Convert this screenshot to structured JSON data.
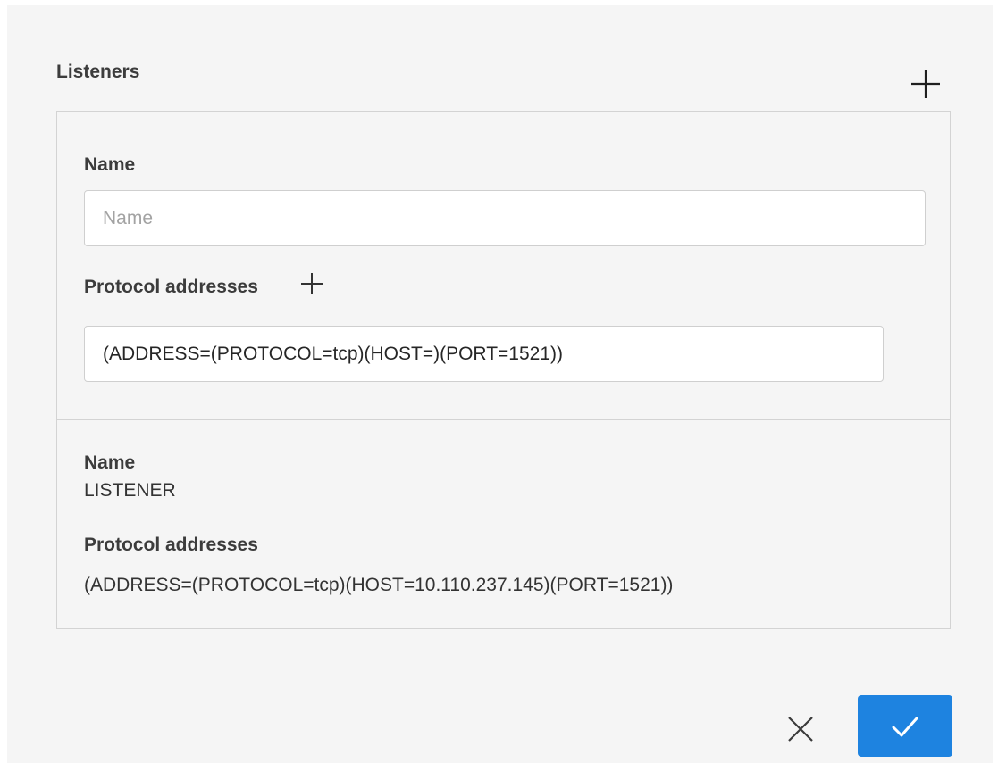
{
  "listeners": {
    "title": "Listeners",
    "add_icon": "plus-icon",
    "editor": {
      "name_label": "Name",
      "name_value": "",
      "name_placeholder": "Name",
      "protocol_label": "Protocol addresses",
      "protocol_add_icon": "plus-icon",
      "protocol_value": "(ADDRESS=(PROTOCOL=tcp)(HOST=)(PORT=1521))"
    },
    "items": [
      {
        "name_label": "Name",
        "name": "LISTENER",
        "protocol_label": "Protocol addresses",
        "protocol": "(ADDRESS=(PROTOCOL=tcp)(HOST=10.110.237.145)(PORT=1521))"
      }
    ]
  },
  "actions": {
    "cancel_icon": "close-icon",
    "confirm_icon": "checkmark-icon"
  },
  "colors": {
    "accent": "#1e83e0",
    "panel_background": "#f5f5f5",
    "border": "#d3d3d3"
  }
}
